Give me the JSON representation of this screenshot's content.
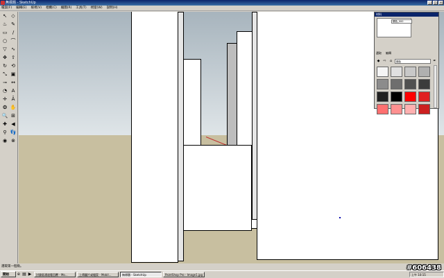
{
  "window": {
    "title": "無標題 - SketchUp",
    "buttons": [
      "_",
      "□",
      "×"
    ]
  },
  "menu": {
    "items": [
      "檔案(F)",
      "編輯(E)",
      "檢視(V)",
      "相機(C)",
      "繪圖(R)",
      "工具(T)",
      "視窗(W)",
      "說明(H)"
    ]
  },
  "tools": [
    {
      "name": "select-icon",
      "glyph": "↖"
    },
    {
      "name": "eraser-icon",
      "glyph": "◇"
    },
    {
      "name": "paint-bucket-icon",
      "glyph": "♨"
    },
    {
      "name": "eraser2-icon",
      "glyph": "✎"
    },
    {
      "name": "rectangle-icon",
      "glyph": "▭"
    },
    {
      "name": "line-icon",
      "glyph": "/"
    },
    {
      "name": "circle-icon",
      "glyph": "○"
    },
    {
      "name": "arc-icon",
      "glyph": "⌒"
    },
    {
      "name": "polygon-icon",
      "glyph": "▽"
    },
    {
      "name": "freehand-icon",
      "glyph": "∿"
    },
    {
      "name": "move-icon",
      "glyph": "✥"
    },
    {
      "name": "push-pull-icon",
      "glyph": "⇧"
    },
    {
      "name": "rotate-icon",
      "glyph": "↻"
    },
    {
      "name": "follow-me-icon",
      "glyph": "⟲"
    },
    {
      "name": "scale-icon",
      "glyph": "⤡"
    },
    {
      "name": "offset-icon",
      "glyph": "▣"
    },
    {
      "name": "tape-measure-icon",
      "glyph": "⊸"
    },
    {
      "name": "dimension-icon",
      "glyph": "↔"
    },
    {
      "name": "protractor-icon",
      "glyph": "◔"
    },
    {
      "name": "text-icon",
      "glyph": "A"
    },
    {
      "name": "axes-icon",
      "glyph": "✛"
    },
    {
      "name": "3d-text-icon",
      "glyph": "Ā"
    },
    {
      "name": "orbit-icon",
      "glyph": "❂"
    },
    {
      "name": "pan-icon",
      "glyph": "✋"
    },
    {
      "name": "zoom-icon",
      "glyph": "🔍"
    },
    {
      "name": "zoom-window-icon",
      "glyph": "⊞"
    },
    {
      "name": "zoom-extents-icon",
      "glyph": "✚"
    },
    {
      "name": "previous-icon",
      "glyph": "◀"
    },
    {
      "name": "position-camera-icon",
      "glyph": "⚲"
    },
    {
      "name": "walk-icon",
      "glyph": "👣"
    },
    {
      "name": "look-around-icon",
      "glyph": "◉"
    },
    {
      "name": "section-icon",
      "glyph": "⊗"
    }
  ],
  "materials": {
    "title": "材料",
    "name_value": "顏色_000",
    "tabs": [
      "選取",
      "編輯"
    ],
    "dropdown": "顏色",
    "swatches": [
      "#f5f5f5",
      "#e0e0e0",
      "#c8c8c8",
      "#b0b0b0",
      "#8c8c8c",
      "#6e6e6e",
      "#505050",
      "#3c3c3c",
      "#202020",
      "#000000",
      "#ff0000",
      "#e02020",
      "#ff7070",
      "#ff9090",
      "#ffb0b0",
      "#cc2020"
    ]
  },
  "status": {
    "text": "選取第一個角。"
  },
  "taskbar": {
    "start": "開始",
    "quicklaunch": [
      {
        "name": "ie-icon",
        "glyph": "e"
      },
      {
        "name": "folder-icon",
        "glyph": "▤"
      },
      {
        "name": "media-icon",
        "glyph": "▶"
      }
    ],
    "tasks": [
      {
        "label": "討論區通道看回覆 - Mo...",
        "active": false
      },
      {
        "label": "上傳圖片或檔案 - Mobil...",
        "active": false
      },
      {
        "label": "無標題 - SketchUp",
        "active": true
      },
      {
        "label": "PaintShop Pro - Image1.jpg",
        "active": false
      }
    ],
    "tray_time": "上午 10:15"
  },
  "watermark": "#606438"
}
